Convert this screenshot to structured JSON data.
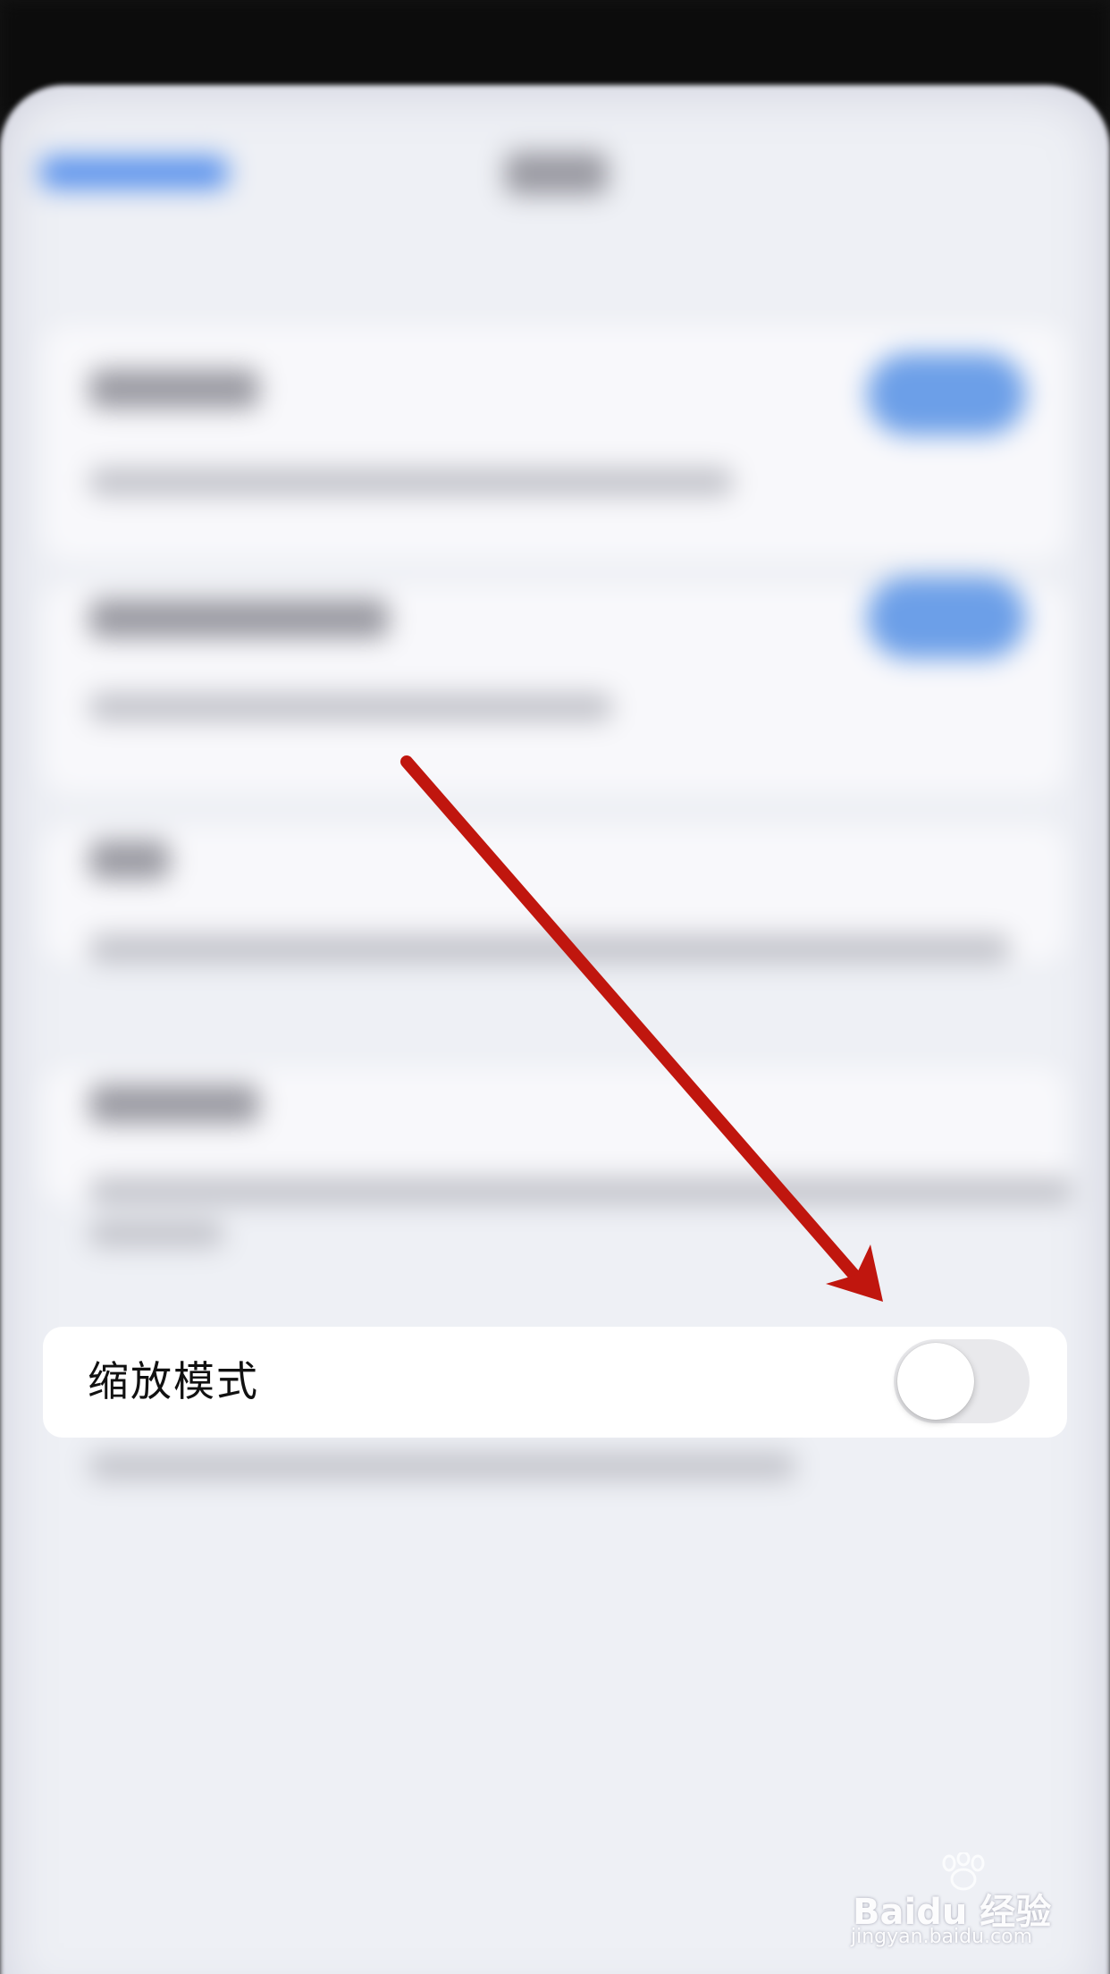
{
  "zoom_setting": {
    "label": "缩放模式",
    "enabled": false
  },
  "watermark": {
    "brand_prefix": "Bai",
    "brand_suffix": "du",
    "brand_cn": "经验",
    "url": "jingyan.baidu.com"
  },
  "colors": {
    "annotation_arrow": "#c0160e",
    "toggle_off_track": "#e9e9ec",
    "page_background": "#eef0f5",
    "blurred_toggle_on": "#6c9fe8"
  }
}
